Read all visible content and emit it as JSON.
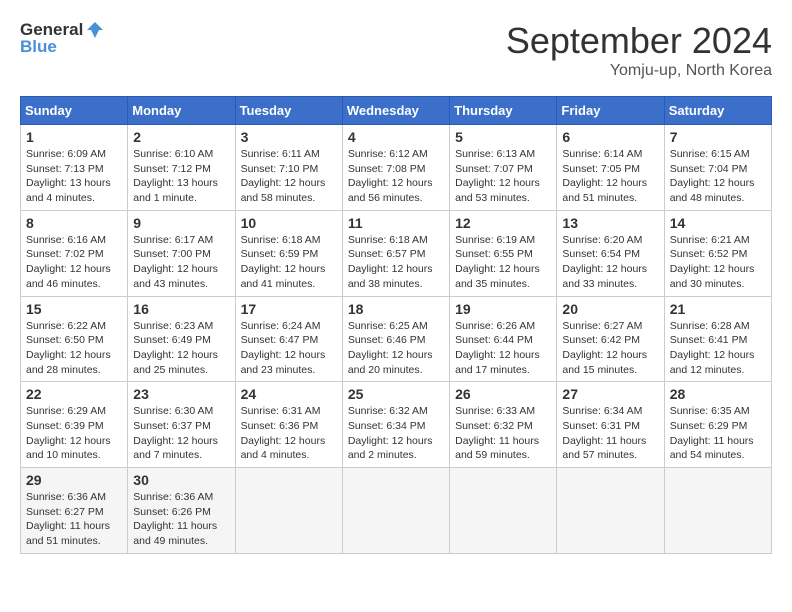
{
  "logo": {
    "text_general": "General",
    "text_blue": "Blue"
  },
  "title": "September 2024",
  "subtitle": "Yomju-up, North Korea",
  "weekdays": [
    "Sunday",
    "Monday",
    "Tuesday",
    "Wednesday",
    "Thursday",
    "Friday",
    "Saturday"
  ],
  "weeks": [
    [
      {
        "day": "1",
        "sunrise": "6:09 AM",
        "sunset": "7:13 PM",
        "daylight": "13 hours and 4 minutes."
      },
      {
        "day": "2",
        "sunrise": "6:10 AM",
        "sunset": "7:12 PM",
        "daylight": "13 hours and 1 minute."
      },
      {
        "day": "3",
        "sunrise": "6:11 AM",
        "sunset": "7:10 PM",
        "daylight": "12 hours and 58 minutes."
      },
      {
        "day": "4",
        "sunrise": "6:12 AM",
        "sunset": "7:08 PM",
        "daylight": "12 hours and 56 minutes."
      },
      {
        "day": "5",
        "sunrise": "6:13 AM",
        "sunset": "7:07 PM",
        "daylight": "12 hours and 53 minutes."
      },
      {
        "day": "6",
        "sunrise": "6:14 AM",
        "sunset": "7:05 PM",
        "daylight": "12 hours and 51 minutes."
      },
      {
        "day": "7",
        "sunrise": "6:15 AM",
        "sunset": "7:04 PM",
        "daylight": "12 hours and 48 minutes."
      }
    ],
    [
      {
        "day": "8",
        "sunrise": "6:16 AM",
        "sunset": "7:02 PM",
        "daylight": "12 hours and 46 minutes."
      },
      {
        "day": "9",
        "sunrise": "6:17 AM",
        "sunset": "7:00 PM",
        "daylight": "12 hours and 43 minutes."
      },
      {
        "day": "10",
        "sunrise": "6:18 AM",
        "sunset": "6:59 PM",
        "daylight": "12 hours and 41 minutes."
      },
      {
        "day": "11",
        "sunrise": "6:18 AM",
        "sunset": "6:57 PM",
        "daylight": "12 hours and 38 minutes."
      },
      {
        "day": "12",
        "sunrise": "6:19 AM",
        "sunset": "6:55 PM",
        "daylight": "12 hours and 35 minutes."
      },
      {
        "day": "13",
        "sunrise": "6:20 AM",
        "sunset": "6:54 PM",
        "daylight": "12 hours and 33 minutes."
      },
      {
        "day": "14",
        "sunrise": "6:21 AM",
        "sunset": "6:52 PM",
        "daylight": "12 hours and 30 minutes."
      }
    ],
    [
      {
        "day": "15",
        "sunrise": "6:22 AM",
        "sunset": "6:50 PM",
        "daylight": "12 hours and 28 minutes."
      },
      {
        "day": "16",
        "sunrise": "6:23 AM",
        "sunset": "6:49 PM",
        "daylight": "12 hours and 25 minutes."
      },
      {
        "day": "17",
        "sunrise": "6:24 AM",
        "sunset": "6:47 PM",
        "daylight": "12 hours and 23 minutes."
      },
      {
        "day": "18",
        "sunrise": "6:25 AM",
        "sunset": "6:46 PM",
        "daylight": "12 hours and 20 minutes."
      },
      {
        "day": "19",
        "sunrise": "6:26 AM",
        "sunset": "6:44 PM",
        "daylight": "12 hours and 17 minutes."
      },
      {
        "day": "20",
        "sunrise": "6:27 AM",
        "sunset": "6:42 PM",
        "daylight": "12 hours and 15 minutes."
      },
      {
        "day": "21",
        "sunrise": "6:28 AM",
        "sunset": "6:41 PM",
        "daylight": "12 hours and 12 minutes."
      }
    ],
    [
      {
        "day": "22",
        "sunrise": "6:29 AM",
        "sunset": "6:39 PM",
        "daylight": "12 hours and 10 minutes."
      },
      {
        "day": "23",
        "sunrise": "6:30 AM",
        "sunset": "6:37 PM",
        "daylight": "12 hours and 7 minutes."
      },
      {
        "day": "24",
        "sunrise": "6:31 AM",
        "sunset": "6:36 PM",
        "daylight": "12 hours and 4 minutes."
      },
      {
        "day": "25",
        "sunrise": "6:32 AM",
        "sunset": "6:34 PM",
        "daylight": "12 hours and 2 minutes."
      },
      {
        "day": "26",
        "sunrise": "6:33 AM",
        "sunset": "6:32 PM",
        "daylight": "11 hours and 59 minutes."
      },
      {
        "day": "27",
        "sunrise": "6:34 AM",
        "sunset": "6:31 PM",
        "daylight": "11 hours and 57 minutes."
      },
      {
        "day": "28",
        "sunrise": "6:35 AM",
        "sunset": "6:29 PM",
        "daylight": "11 hours and 54 minutes."
      }
    ],
    [
      {
        "day": "29",
        "sunrise": "6:36 AM",
        "sunset": "6:27 PM",
        "daylight": "11 hours and 51 minutes."
      },
      {
        "day": "30",
        "sunrise": "6:36 AM",
        "sunset": "6:26 PM",
        "daylight": "11 hours and 49 minutes."
      },
      null,
      null,
      null,
      null,
      null
    ]
  ]
}
